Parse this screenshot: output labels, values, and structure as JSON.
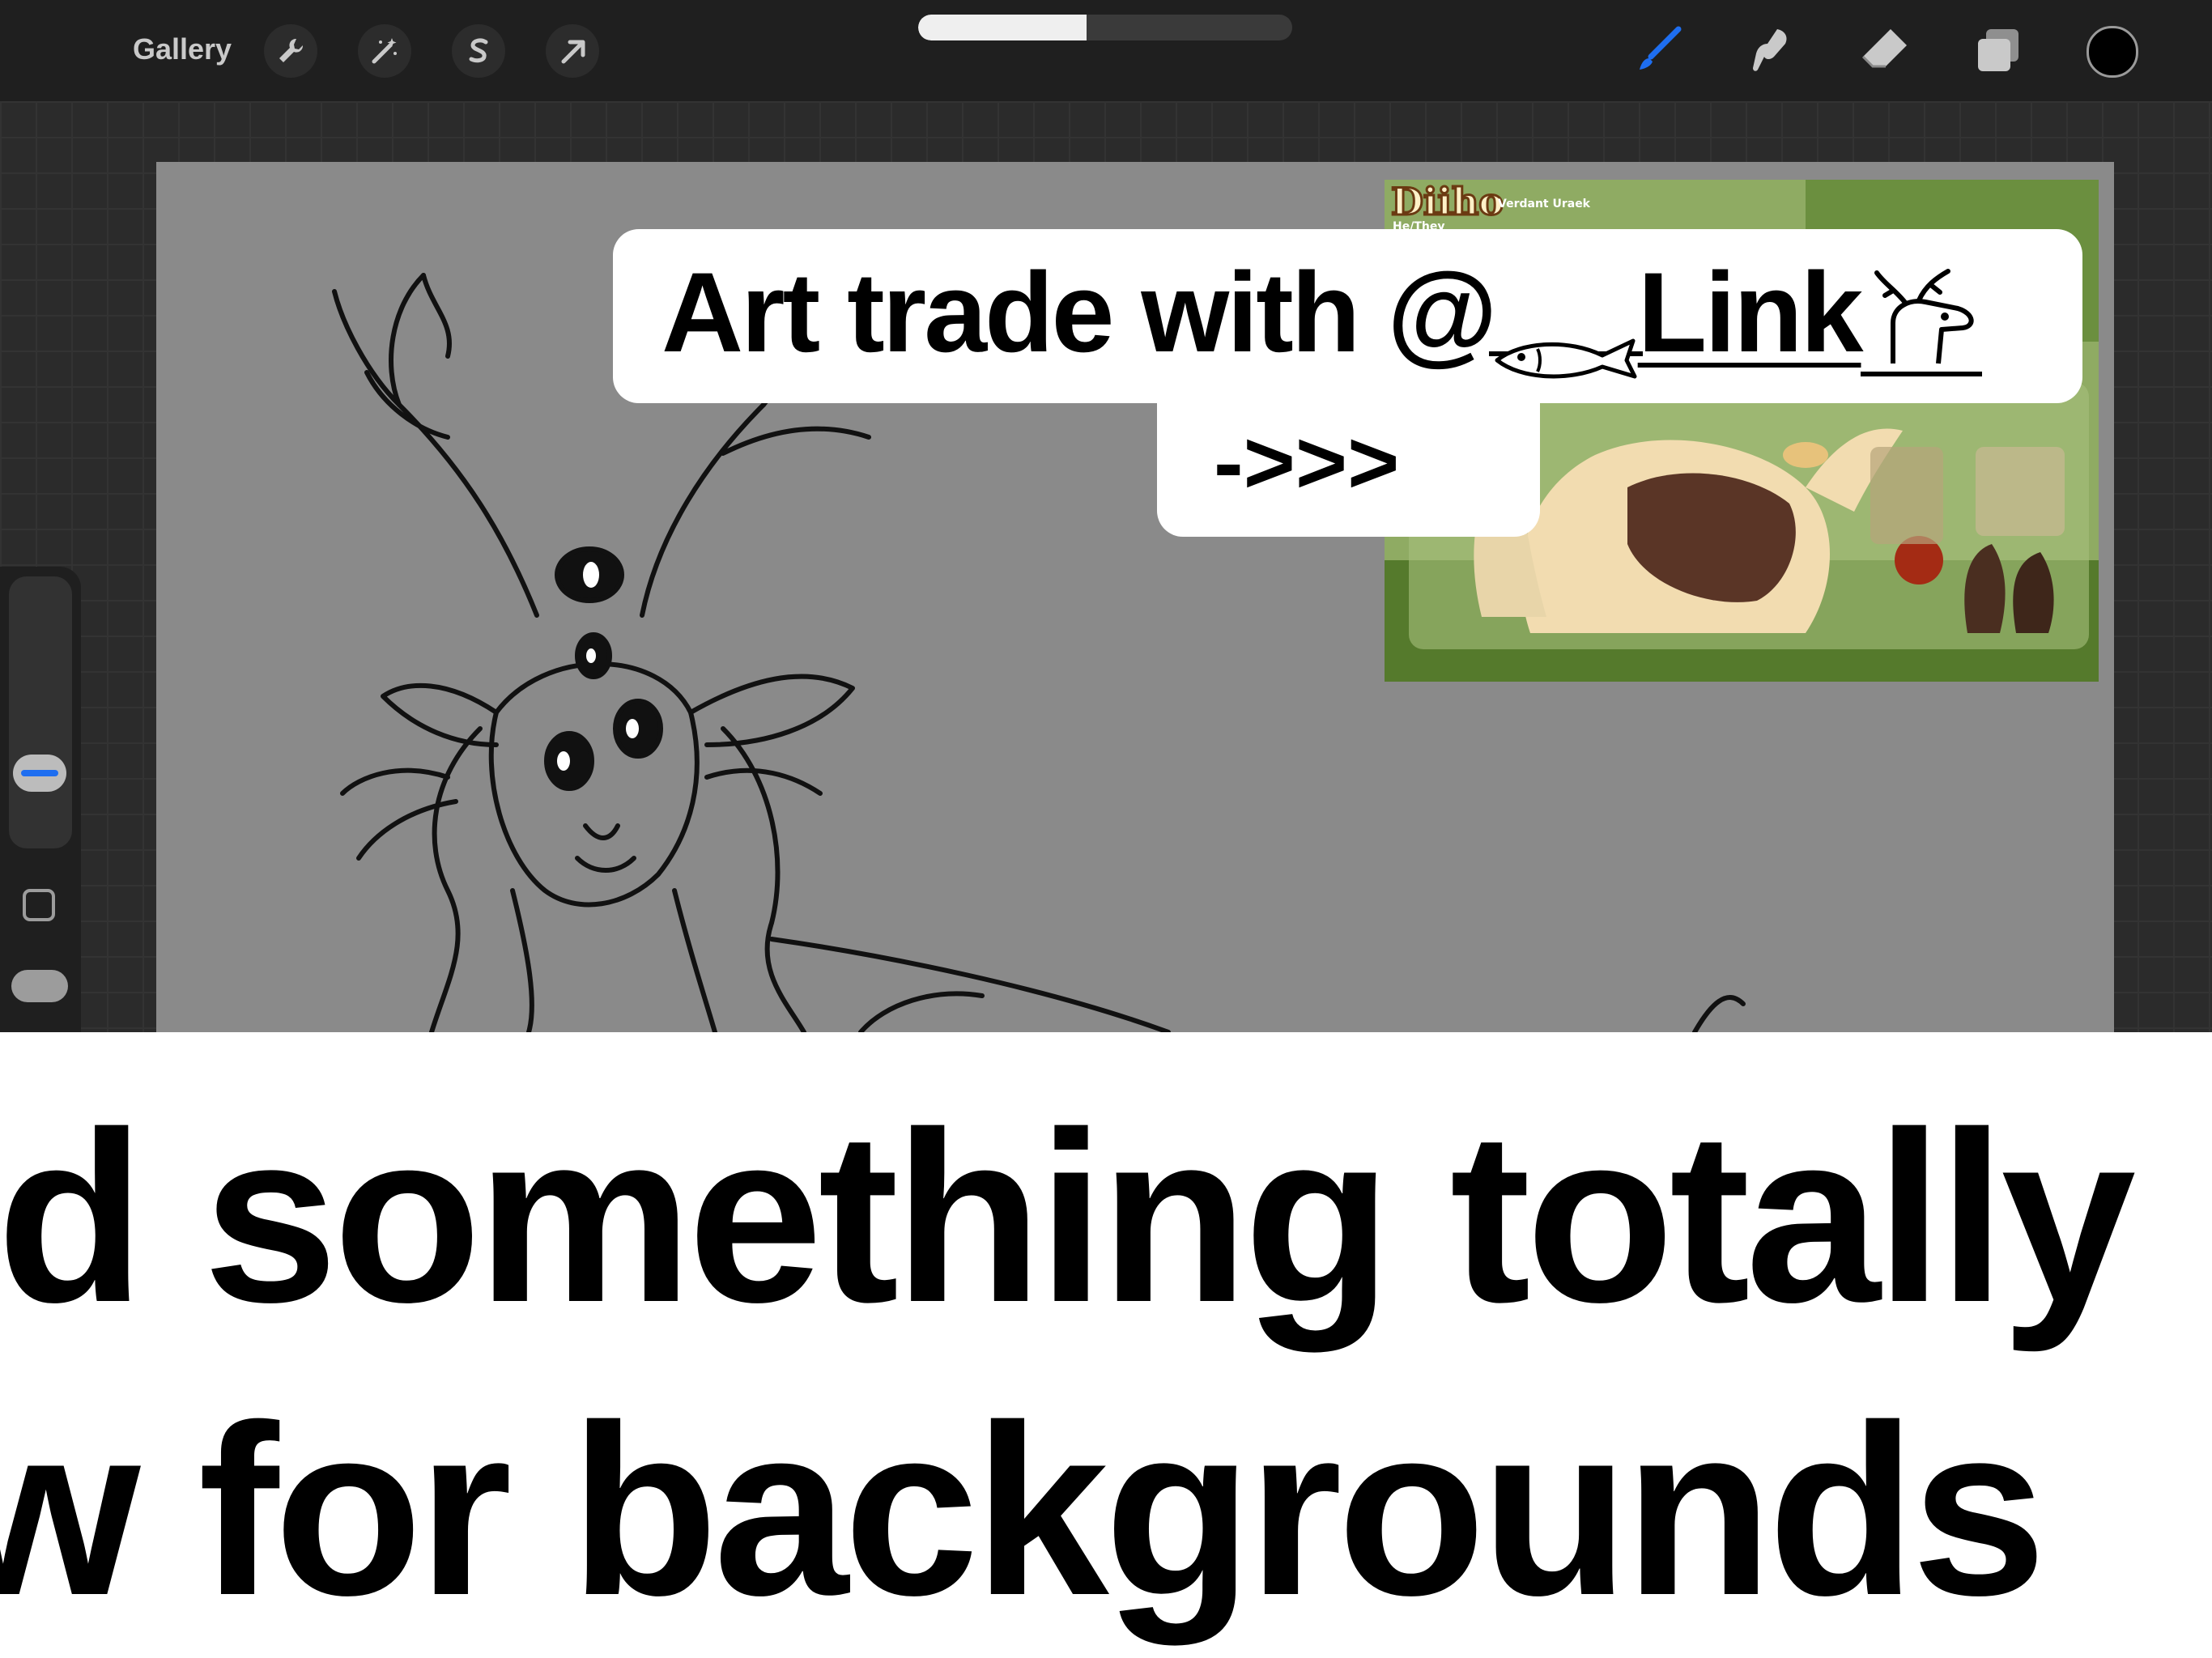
{
  "toolbar": {
    "gallery_label": "Gallery",
    "left_tools": [
      "wrench-icon",
      "magic-wand-icon",
      "selection-icon",
      "transform-arrow-icon"
    ],
    "right_tools": [
      "brush-icon",
      "smudge-icon",
      "eraser-icon",
      "layers-icon"
    ],
    "active_tool": "brush-icon",
    "progress": 0.45,
    "current_color": "#000000",
    "accent_color": "#1e6ef0"
  },
  "overlay": {
    "title_prefix": "Art trade with @",
    "title_name": "Link",
    "arrow_text": "->>>"
  },
  "reference": {
    "name": "Diiho",
    "species": "Verdant Uraek",
    "pronouns": "He/They"
  },
  "caption": {
    "line1": "d something totally",
    "line2": "w for backgrounds"
  },
  "colors": {
    "toolbar_bg": "#1f1f1f",
    "canvas_bg": "#8a8a8a",
    "caption_bg": "#ffffff"
  }
}
